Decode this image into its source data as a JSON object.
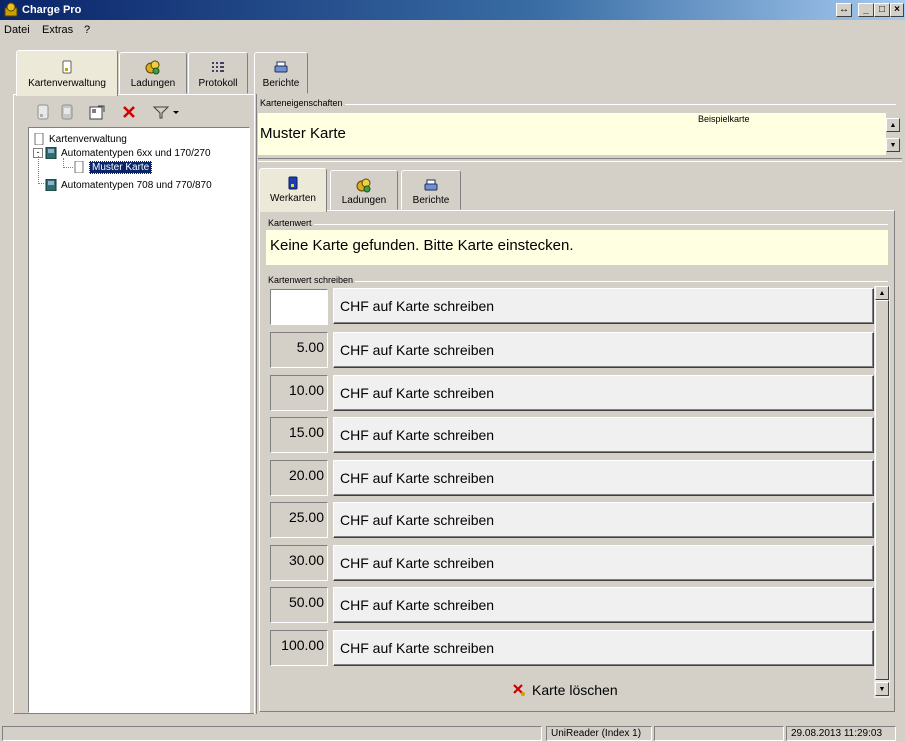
{
  "window": {
    "title": "Charge Pro",
    "buttons": [
      "↔",
      "_",
      "□",
      "×"
    ]
  },
  "menu": [
    "Datei",
    "Extras",
    "?"
  ],
  "main_tabs": [
    {
      "label": "Kartenverwaltung",
      "icon": "card-icon",
      "active": true
    },
    {
      "label": "Ladungen",
      "icon": "coins-icon"
    },
    {
      "label": "Protokoll",
      "icon": "grid-icon"
    },
    {
      "label": "Berichte",
      "icon": "printer-icon"
    }
  ],
  "tree": {
    "items": [
      {
        "label": "Kartenverwaltung"
      },
      {
        "label": "Automatentypen 6xx und 170/270"
      },
      {
        "label": "Muster Karte"
      },
      {
        "label": "Automatentypen 708 und 770/870"
      }
    ]
  },
  "card_properties": {
    "group_label": "Karteneigenschaften",
    "name": "Muster Karte",
    "description": "Beispielkarte"
  },
  "sub_tabs": [
    {
      "label": "Werkarten",
      "active": true
    },
    {
      "label": "Ladungen"
    },
    {
      "label": "Berichte"
    }
  ],
  "card_value": {
    "group_label": "Kartenwert",
    "message": "Keine Karte gefunden. Bitte Karte einstecken."
  },
  "write_value": {
    "group_label": "Kartenwert schreiben",
    "rows": [
      {
        "amount": "",
        "label": "CHF auf Karte schreiben"
      },
      {
        "amount": "5.00",
        "label": "CHF auf Karte schreiben"
      },
      {
        "amount": "10.00",
        "label": "CHF auf Karte schreiben"
      },
      {
        "amount": "15.00",
        "label": "CHF auf Karte schreiben"
      },
      {
        "amount": "20.00",
        "label": "CHF auf Karte schreiben"
      },
      {
        "amount": "25.00",
        "label": "CHF auf Karte schreiben"
      },
      {
        "amount": "30.00",
        "label": "CHF auf Karte schreiben"
      },
      {
        "amount": "50.00",
        "label": "CHF auf Karte schreiben"
      },
      {
        "amount": "100.00",
        "label": "CHF auf Karte schreiben"
      }
    ],
    "delete_label": "Karte löschen"
  },
  "status": {
    "reader": "UniReader (Index 1)",
    "datetime": "29.08.2013 11:29:03"
  }
}
